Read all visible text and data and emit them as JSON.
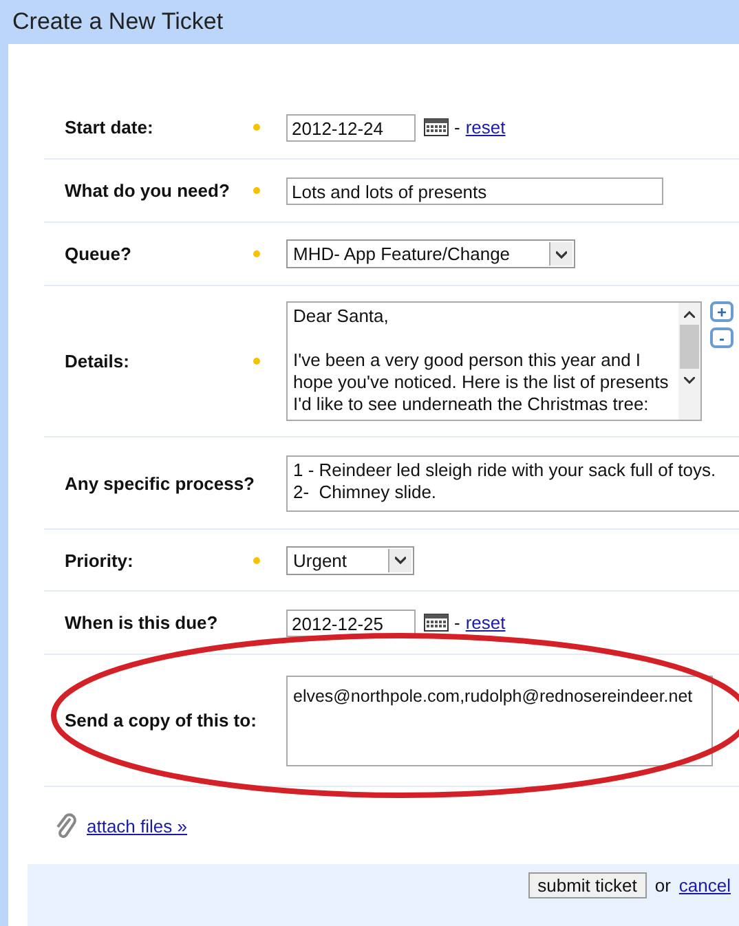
{
  "window": {
    "title": "Create a New Ticket"
  },
  "fields": [
    {
      "kind": "date",
      "label": "Start date:",
      "required": true,
      "value": "2012-12-24",
      "separator": "-",
      "link": "reset"
    },
    {
      "kind": "text",
      "label": "What do you need?",
      "required": true,
      "value": "Lots and lots of presents"
    },
    {
      "kind": "select",
      "label": "Queue?",
      "required": true,
      "value": "MHD- App Feature/Change"
    },
    {
      "kind": "textarea",
      "label": "Details:",
      "required": true,
      "value": "Dear Santa,\n\nI've been a very good person this year and I hope you've noticed. Here is the list of presents I'd like to see underneath the Christmas tree:",
      "resize_buttons": [
        "+",
        "-"
      ]
    },
    {
      "kind": "textarea",
      "label": "Any specific process?",
      "required": false,
      "value": "1 - Reindeer led sleigh ride with your sack full of toys.\n2-  Chimney slide."
    },
    {
      "kind": "select",
      "label": "Priority:",
      "required": true,
      "value": "Urgent"
    },
    {
      "kind": "date",
      "label": "When is this due?",
      "required": false,
      "value": "2012-12-25",
      "separator": "-",
      "link": "reset"
    },
    {
      "kind": "textarea",
      "label": "Send a copy of this to:",
      "required": false,
      "value": "elves@northpole.com,rudolph@rednosereindeer.net"
    }
  ],
  "attach": {
    "label": "attach files »"
  },
  "footer": {
    "submit": "submit ticket",
    "or": "or",
    "cancel": "cancel"
  }
}
